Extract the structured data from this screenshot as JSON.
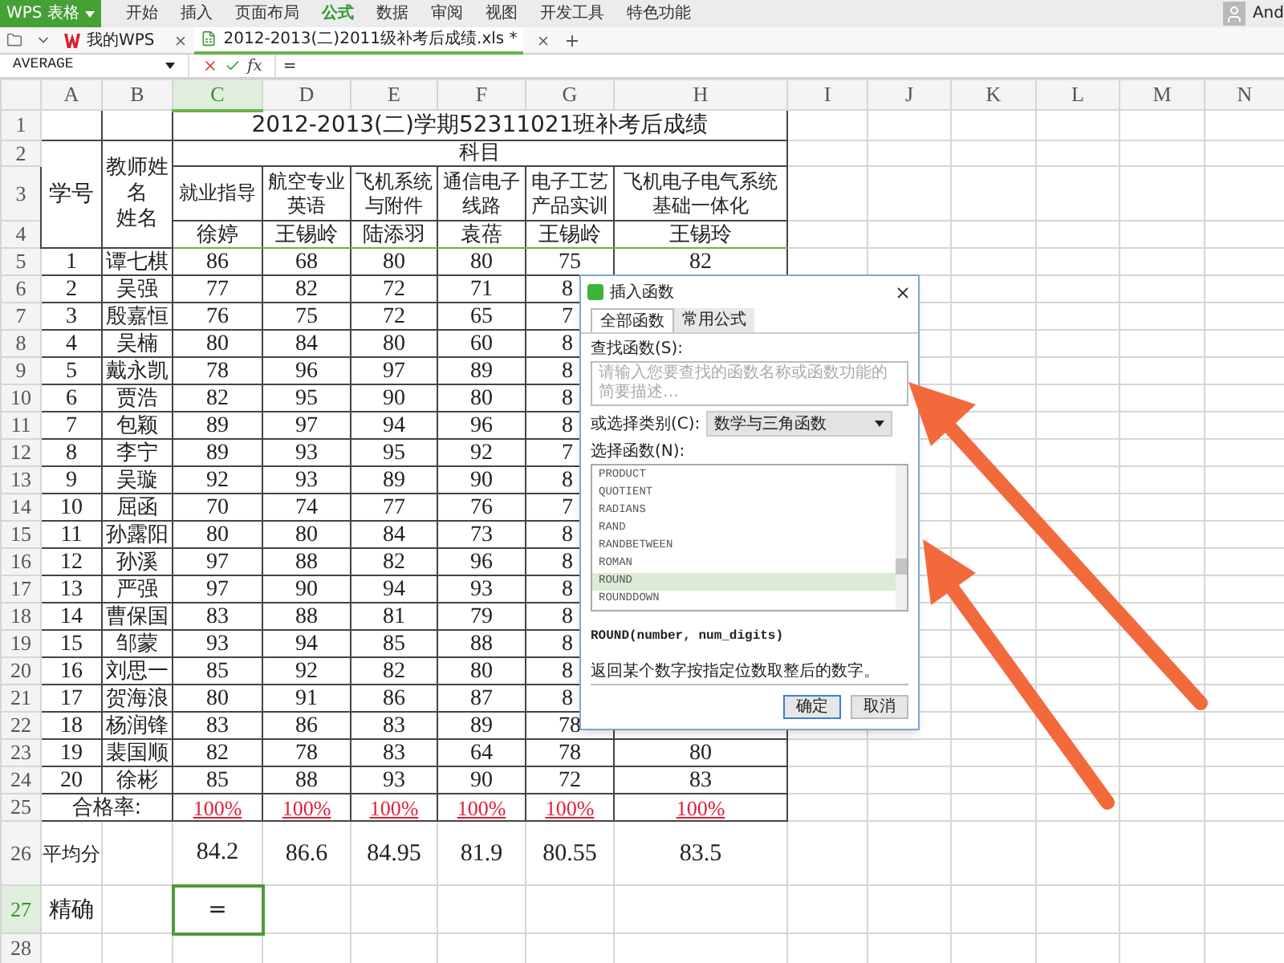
{
  "app_button": "WPS 表格",
  "ribbon_tabs": [
    {
      "label": "开始",
      "selected": false
    },
    {
      "label": "插入",
      "selected": false
    },
    {
      "label": "页面布局",
      "selected": false
    },
    {
      "label": "公式",
      "selected": true
    },
    {
      "label": "数据",
      "selected": false
    },
    {
      "label": "审阅",
      "selected": false
    },
    {
      "label": "视图",
      "selected": false
    },
    {
      "label": "开发工具",
      "selected": false
    },
    {
      "label": "特色功能",
      "selected": false
    }
  ],
  "user": "And",
  "doc_tabs": [
    {
      "label": "我的WPS",
      "selected": false,
      "kind": "home"
    },
    {
      "label": "2012-2013(二)2011级补考后成绩.xls *",
      "selected": true,
      "kind": "sheet"
    }
  ],
  "formula_bar": {
    "name_box": "AVERAGE",
    "fx": "fx",
    "formula": "="
  },
  "columns": [
    {
      "letter": "A",
      "selected": false
    },
    {
      "letter": "B",
      "selected": false
    },
    {
      "letter": "C",
      "selected": true
    },
    {
      "letter": "D",
      "selected": false
    },
    {
      "letter": "E",
      "selected": false
    },
    {
      "letter": "F",
      "selected": false
    },
    {
      "letter": "G",
      "selected": false
    },
    {
      "letter": "H",
      "selected": false
    },
    {
      "letter": "I",
      "selected": false
    },
    {
      "letter": "J",
      "selected": false
    },
    {
      "letter": "K",
      "selected": false
    },
    {
      "letter": "L",
      "selected": false
    },
    {
      "letter": "M",
      "selected": false
    },
    {
      "letter": "N",
      "selected": false
    }
  ],
  "header_rows": [
    "1",
    "2",
    "3",
    "4"
  ],
  "title": "2012-2013(二)学期52311021班补考后成绩",
  "header": {
    "number_label": "学号",
    "teacher_label": [
      "教师姓",
      "名",
      "姓名"
    ],
    "subject_group": "科目"
  },
  "subjects": [
    {
      "name": "就业指导",
      "teacher": "徐婷"
    },
    {
      "name": "航空专业英语",
      "teacher": "王锡岭"
    },
    {
      "name": "飞机系统与附件",
      "teacher": "陆添羽"
    },
    {
      "name": "通信电子线路",
      "teacher": "袁蓓"
    },
    {
      "name": "电子工艺产品实训",
      "teacher": "王锡岭"
    },
    {
      "name": "飞机电子电气系统基础一体化",
      "teacher": "王锡玲"
    }
  ],
  "students": [
    {
      "row": "5",
      "no": "1",
      "name": "谭七棋",
      "scores": [
        "86",
        "68",
        "80",
        "80",
        "75",
        "82"
      ]
    },
    {
      "row": "6",
      "no": "2",
      "name": "吴强",
      "scores": [
        "77",
        "82",
        "72",
        "71",
        "8"
      ]
    },
    {
      "row": "7",
      "no": "3",
      "name": "殷嘉恒",
      "scores": [
        "76",
        "75",
        "72",
        "65",
        "7"
      ]
    },
    {
      "row": "8",
      "no": "4",
      "name": "吴楠",
      "scores": [
        "80",
        "84",
        "80",
        "60",
        "8"
      ]
    },
    {
      "row": "9",
      "no": "5",
      "name": "戴永凯",
      "scores": [
        "78",
        "96",
        "97",
        "89",
        "8"
      ]
    },
    {
      "row": "10",
      "no": "6",
      "name": "贾浩",
      "scores": [
        "82",
        "95",
        "90",
        "80",
        "8"
      ]
    },
    {
      "row": "11",
      "no": "7",
      "name": "包颖",
      "scores": [
        "89",
        "97",
        "94",
        "96",
        "8"
      ]
    },
    {
      "row": "12",
      "no": "8",
      "name": "李宁",
      "scores": [
        "89",
        "93",
        "95",
        "92",
        "7"
      ]
    },
    {
      "row": "13",
      "no": "9",
      "name": "吴璇",
      "scores": [
        "92",
        "93",
        "89",
        "90",
        "8"
      ]
    },
    {
      "row": "14",
      "no": "10",
      "name": "屈函",
      "scores": [
        "70",
        "74",
        "77",
        "76",
        "7"
      ]
    },
    {
      "row": "15",
      "no": "11",
      "name": "孙露阳",
      "scores": [
        "80",
        "80",
        "84",
        "73",
        "8"
      ]
    },
    {
      "row": "16",
      "no": "12",
      "name": "孙溪",
      "scores": [
        "97",
        "88",
        "82",
        "96",
        "8"
      ]
    },
    {
      "row": "17",
      "no": "13",
      "name": "严强",
      "scores": [
        "97",
        "90",
        "94",
        "93",
        "8"
      ]
    },
    {
      "row": "18",
      "no": "14",
      "name": "曹保国",
      "scores": [
        "83",
        "88",
        "81",
        "79",
        "8"
      ]
    },
    {
      "row": "19",
      "no": "15",
      "name": "邹蒙",
      "scores": [
        "93",
        "94",
        "85",
        "88",
        "8"
      ]
    },
    {
      "row": "20",
      "no": "16",
      "name": "刘思一",
      "scores": [
        "85",
        "92",
        "82",
        "80",
        "8"
      ]
    },
    {
      "row": "21",
      "no": "17",
      "name": "贺海浪",
      "scores": [
        "80",
        "91",
        "86",
        "87",
        "8"
      ]
    },
    {
      "row": "22",
      "no": "18",
      "name": "杨润锋",
      "scores": [
        "83",
        "86",
        "83",
        "89",
        "78"
      ]
    },
    {
      "row": "23",
      "no": "19",
      "name": "裴国顺",
      "scores": [
        "82",
        "78",
        "83",
        "64",
        "78",
        "80"
      ]
    },
    {
      "row": "24",
      "no": "20",
      "name": "徐彬",
      "scores": [
        "85",
        "88",
        "93",
        "90",
        "72",
        "83"
      ]
    }
  ],
  "pass_rate": {
    "row": "25",
    "label": "合格率:",
    "values": [
      "100%",
      "100%",
      "100%",
      "100%",
      "100%",
      "100%"
    ]
  },
  "average": {
    "row": "26",
    "label": "平均分",
    "values": [
      "84.2",
      "86.6",
      "84.95",
      "81.9",
      "80.55",
      "83.5"
    ]
  },
  "precise": {
    "row": "27",
    "label": "精确",
    "value": "=",
    "selected": true
  },
  "last_row": "28",
  "dialog": {
    "title": "插入函数",
    "tabs": [
      {
        "label": "全部函数",
        "selected": true
      },
      {
        "label": "常用公式",
        "selected": false
      }
    ],
    "search_label": "查找函数(S):",
    "search_placeholder": "请输入您要查找的函数名称或函数功能的简要描述…",
    "category_label": "或选择类别(C):",
    "category": "数学与三角函数",
    "list_label": "选择函数(N):",
    "functions": [
      {
        "name": "PRODUCT",
        "selected": false
      },
      {
        "name": "QUOTIENT",
        "selected": false
      },
      {
        "name": "RADIANS",
        "selected": false
      },
      {
        "name": "RAND",
        "selected": false
      },
      {
        "name": "RANDBETWEEN",
        "selected": false
      },
      {
        "name": "ROMAN",
        "selected": false
      },
      {
        "name": "ROUND",
        "selected": true
      },
      {
        "name": "ROUNDDOWN",
        "selected": false
      }
    ],
    "signature": "ROUND(number, num_digits)",
    "description": "返回某个数字按指定位数取整后的数字。",
    "buttons": [
      "确定",
      "取消"
    ]
  }
}
